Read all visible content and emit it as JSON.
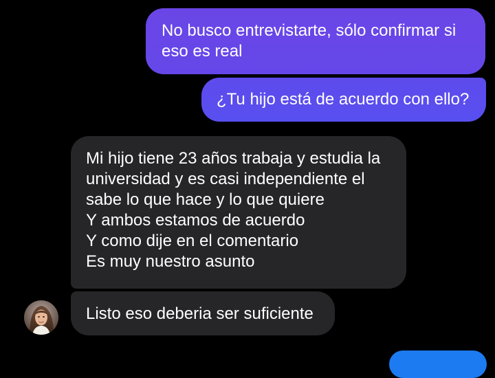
{
  "conversation": {
    "messages": [
      {
        "direction": "sent",
        "lines": [
          "No busco entrevistarte, sólo confirmar si",
          "eso es real"
        ]
      },
      {
        "direction": "sent",
        "lines": [
          "¿Tu hijo está de acuerdo con ello?"
        ]
      },
      {
        "direction": "received",
        "lines": [
          "Mi hijo tiene 23 años trabaja y estudia la",
          "universidad y es casi independiente el",
          "sabe lo que hace y lo que quiere",
          "Y ambos estamos de acuerdo",
          "Y como dije en el comentario",
          "Es muy nuestro asunto"
        ]
      },
      {
        "direction": "received",
        "lines": [
          "Listo eso deberia ser suficiente"
        ]
      }
    ]
  },
  "colors": {
    "background": "#000000",
    "sent_bubble_top": "#6a46e6",
    "sent_bubble_bottom": "#584ff0",
    "received_bubble": "#262628",
    "partial_sent_bubble": "#1c7bf0",
    "text": "#ffffff"
  },
  "icons": {
    "sender_avatar": "contact-avatar-photo"
  }
}
